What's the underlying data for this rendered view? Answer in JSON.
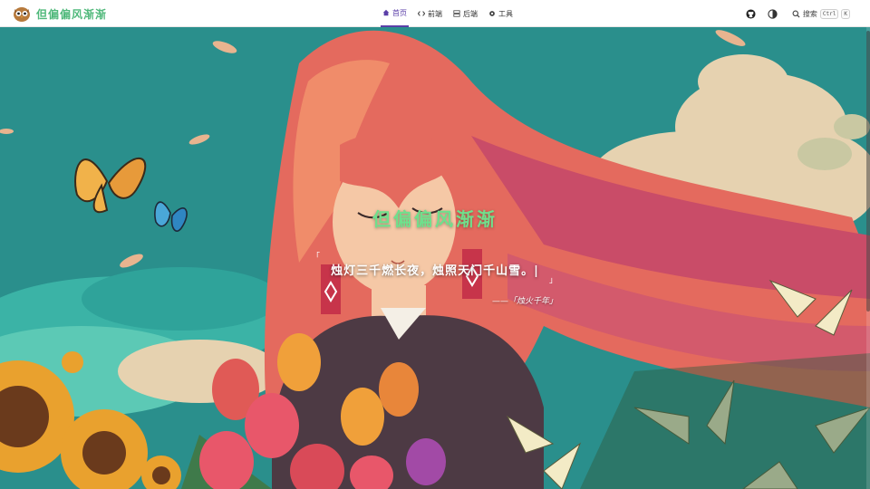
{
  "site": {
    "title": "但偏偏风渐渐"
  },
  "nav": [
    {
      "label": "首页",
      "icon": "home-icon",
      "active": true
    },
    {
      "label": "前端",
      "icon": "code-icon",
      "active": false
    },
    {
      "label": "后端",
      "icon": "server-icon",
      "active": false
    },
    {
      "label": "工具",
      "icon": "gear-icon",
      "active": false
    }
  ],
  "actions": {
    "github_icon": "github-icon",
    "theme_icon": "theme-toggle-icon",
    "search_label": "搜索",
    "search_key1": "Ctrl",
    "search_key2": "K"
  },
  "hero": {
    "title": "但偏偏风渐渐",
    "quote_open": "「",
    "quote": "烛灯三千燃长夜，烛照天门千山雪。|",
    "quote_close": "」",
    "source": "——「烛火千年」"
  },
  "colors": {
    "accent": "#5b3fa8",
    "title_green": "#6fe08c",
    "sky": "#2a8f8c"
  }
}
